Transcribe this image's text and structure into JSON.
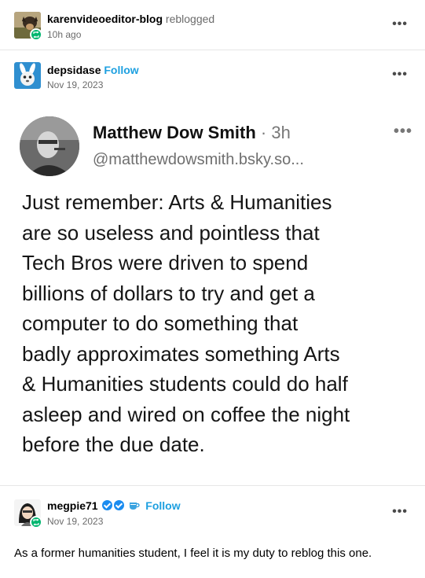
{
  "reblog_header": {
    "username": "karenvideoeditor-blog",
    "action": "reblogged",
    "time": "10h ago",
    "menu": "•••"
  },
  "source_post": {
    "username": "depsidase",
    "follow": "Follow",
    "date": "Nov 19, 2023",
    "menu": "•••"
  },
  "quoted_skeet": {
    "author": "Matthew Dow Smith",
    "time": "· 3h",
    "handle": "@matthewdowsmith.bsky.so...",
    "menu": "•••",
    "lines": [
      "Just remember: Arts & Humanities",
      "are so useless and pointless that",
      "Tech Bros were driven to spend",
      "billions of dollars to try and get a",
      "computer to do something that",
      "badly approximates something Arts",
      "& Humanities students could do half",
      "asleep and wired on coffee the night",
      "before the due date."
    ]
  },
  "reply_post": {
    "username": "megpie71",
    "follow": "Follow",
    "date": "Nov 19, 2023",
    "menu": "•••",
    "text": "As a former humanities student, I feel it is my duty to reblog this one."
  },
  "colors": {
    "follow": "#1ea0e0",
    "reblog_badge": "#00b66f",
    "muted": "#6b6b6b",
    "divider": "#e6e6e6"
  }
}
